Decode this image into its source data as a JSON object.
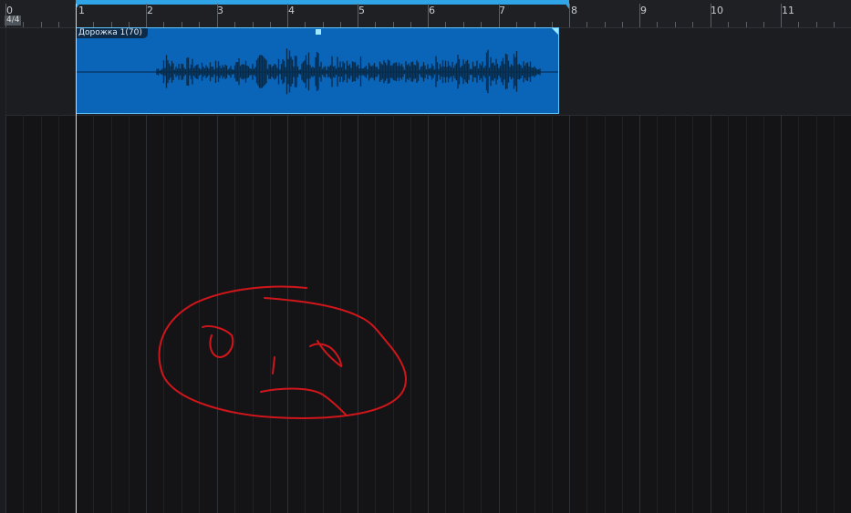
{
  "ruler": {
    "bars": [
      "0",
      "1",
      "2",
      "3",
      "4",
      "5",
      "6",
      "7",
      "8",
      "9",
      "10",
      "11"
    ],
    "time_signature": "4/4"
  },
  "track": {
    "clip_name": "Дорожка 1(70)",
    "clip_color": "#0a64b8",
    "clip_border_color": "#5fc4ff"
  },
  "colors": {
    "accent": "#2fa4e7",
    "background": "#141416",
    "doodle": "#d0161b"
  }
}
